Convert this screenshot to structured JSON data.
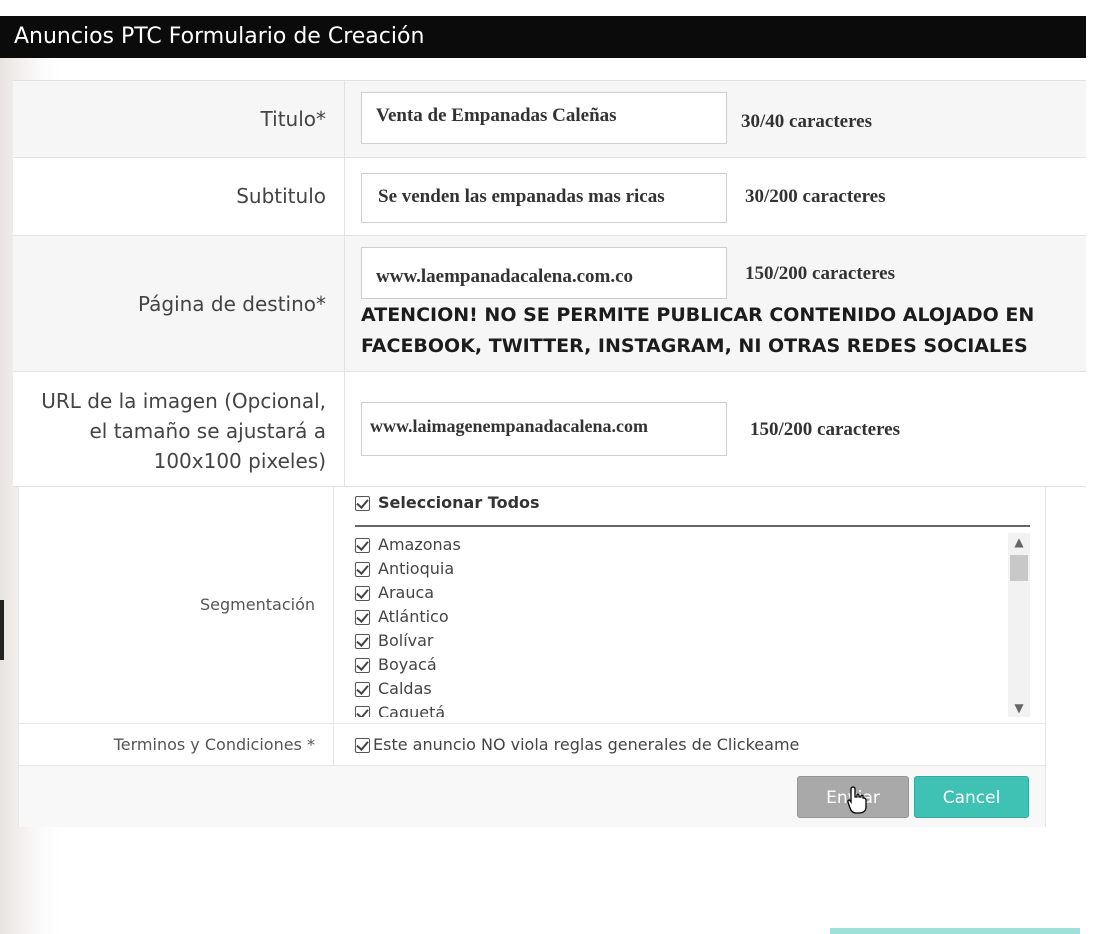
{
  "window": {
    "title": "Anuncios PTC Formulario de Creación"
  },
  "form": {
    "title_field": {
      "label": "Titulo*",
      "value": "Venta de Empanadas Caleñas",
      "counter": "30/40 caracteres"
    },
    "subtitle_field": {
      "label": "Subtitulo",
      "value": "Se venden las empanadas mas ricas",
      "counter": "30/200 caracteres"
    },
    "destination_field": {
      "label": "Página de destino*",
      "value": "www.laempanadacalena.com.co",
      "counter": "150/200 caracteres",
      "warning_line1": "ATENCION! NO SE PERMITE PUBLICAR CONTENIDO ALOJADO EN",
      "warning_line2": "FACEBOOK, TWITTER, INSTAGRAM, NI OTRAS REDES SOCIALES"
    },
    "image_field": {
      "label_line1": "URL de la imagen (Opcional,",
      "label_line2": "el tamaño se ajustará a",
      "label_line3": "100x100 pixeles)",
      "value": "www.laimagenempanadacalena.com",
      "counter": "150/200 caracteres"
    },
    "segmentation": {
      "label": "Segmentación",
      "select_all": "Seleccionar Todos",
      "items": [
        "Amazonas",
        "Antioquia",
        "Arauca",
        "Atlántico",
        "Bolívar",
        "Boyacá",
        "Caldas",
        "Caquetá"
      ]
    },
    "terms": {
      "label": "Terminos y Condiciones *",
      "text": "Este anuncio NO viola reglas generales de Clickeame"
    },
    "buttons": {
      "send": "Enviar",
      "cancel": "Cancel"
    }
  },
  "colors": {
    "titlebar": "#0b0b0b",
    "cancel_button": "#3fc1b4",
    "send_button": "#a9a9a9"
  }
}
